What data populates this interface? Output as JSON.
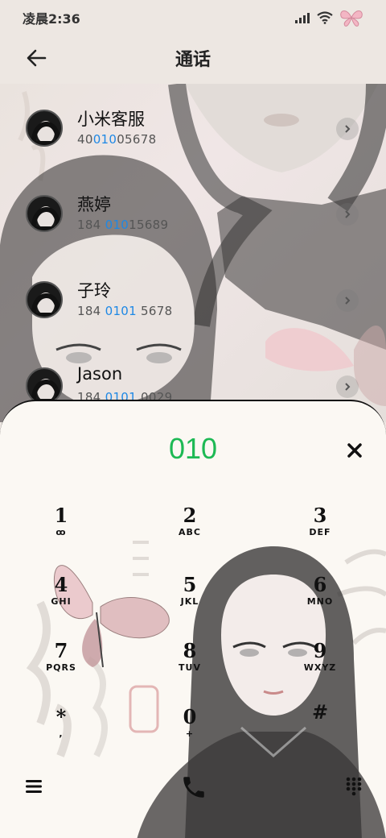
{
  "status": {
    "time": "凌晨2:36"
  },
  "header": {
    "title": "通话"
  },
  "contacts": [
    {
      "name": "小米客服",
      "number_pre": "40",
      "number_hl": "010",
      "number_post": "05678"
    },
    {
      "name": "燕婷",
      "number_pre": "184 ",
      "number_hl": "010",
      "number_post": "15689"
    },
    {
      "name": "子玲",
      "number_pre": "184 ",
      "number_hl": "0101",
      "number_post": " 5678"
    },
    {
      "name": "Jason",
      "number_pre": "184 ",
      "number_hl": "0101",
      "number_post": " 0029"
    }
  ],
  "dialer": {
    "input": "010",
    "keys": [
      {
        "digit": "1",
        "letters": "ꝏ"
      },
      {
        "digit": "2",
        "letters": "ABC"
      },
      {
        "digit": "3",
        "letters": "DEF"
      },
      {
        "digit": "4",
        "letters": "GHI"
      },
      {
        "digit": "5",
        "letters": "JKL"
      },
      {
        "digit": "6",
        "letters": "MNO"
      },
      {
        "digit": "7",
        "letters": "PQRS"
      },
      {
        "digit": "8",
        "letters": "TUV"
      },
      {
        "digit": "9",
        "letters": "WXYZ"
      },
      {
        "digit": "*",
        "letters": ","
      },
      {
        "digit": "0",
        "letters": "+"
      },
      {
        "digit": "#",
        "letters": ""
      }
    ]
  },
  "icons": {
    "back": "back-arrow-icon",
    "signal": "signal-icon",
    "wifi": "wifi-icon",
    "battery": "butterfly-battery-icon",
    "chevron": "chevron-right-icon",
    "clear": "close-icon",
    "menu": "menu-icon",
    "call": "phone-icon",
    "dialpad": "dialpad-icon"
  },
  "colors": {
    "accent": "#1db954",
    "highlight": "#1e88e5"
  }
}
